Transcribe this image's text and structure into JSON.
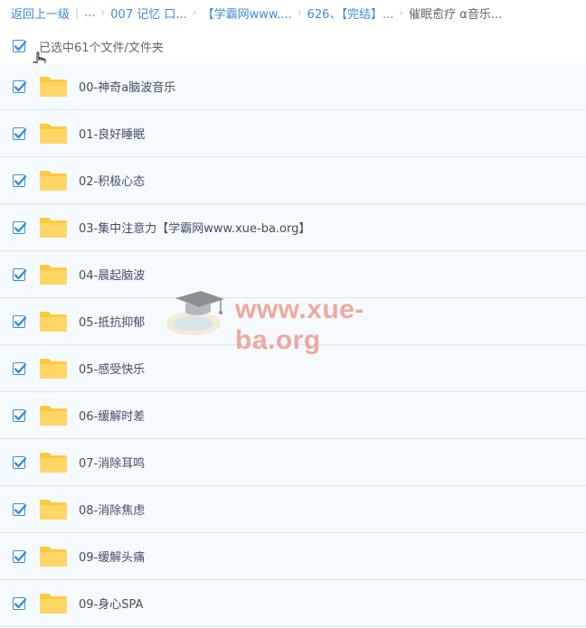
{
  "breadcrumb": {
    "items": [
      {
        "label": "返回上一级",
        "current": false
      },
      {
        "label": "...",
        "current": false
      },
      {
        "label": "007 记忆 口...",
        "current": false
      },
      {
        "label": "【学霸网www....",
        "current": false
      },
      {
        "label": "626、【完结】...",
        "current": false
      },
      {
        "label": "催眠愈疗 α音乐...",
        "current": true
      }
    ],
    "separators": [
      "|",
      "›",
      "›",
      "›",
      "›"
    ]
  },
  "selection": {
    "label": "已选中61个文件/文件夹",
    "checked": true
  },
  "files": [
    {
      "name": "00-神奇a脑波音乐",
      "checked": true
    },
    {
      "name": "01-良好睡眠",
      "checked": true
    },
    {
      "name": "02-积极心态",
      "checked": true
    },
    {
      "name": "03-集中注意力【学霸网www.xue-ba.org】",
      "checked": true
    },
    {
      "name": "04-晨起脑波",
      "checked": true
    },
    {
      "name": "05-抵抗抑郁",
      "checked": true
    },
    {
      "name": "05-感受快乐",
      "checked": true
    },
    {
      "name": "06-缓解时差",
      "checked": true
    },
    {
      "name": "07-消除耳鸣",
      "checked": true
    },
    {
      "name": "08-消除焦虑",
      "checked": true
    },
    {
      "name": "09-缓解头痛",
      "checked": true
    },
    {
      "name": "09-身心SPA",
      "checked": true
    }
  ],
  "watermark": {
    "text": "www.xue-ba.org"
  },
  "colors": {
    "accent": "#3b8cd9",
    "folder": "#ffd25e",
    "row_bg": "#f5fafe",
    "row_border": "#d6e7f5"
  },
  "icons": {
    "checkbox": "check-icon",
    "folder": "folder-icon",
    "cursor": "hand-cursor-icon"
  }
}
